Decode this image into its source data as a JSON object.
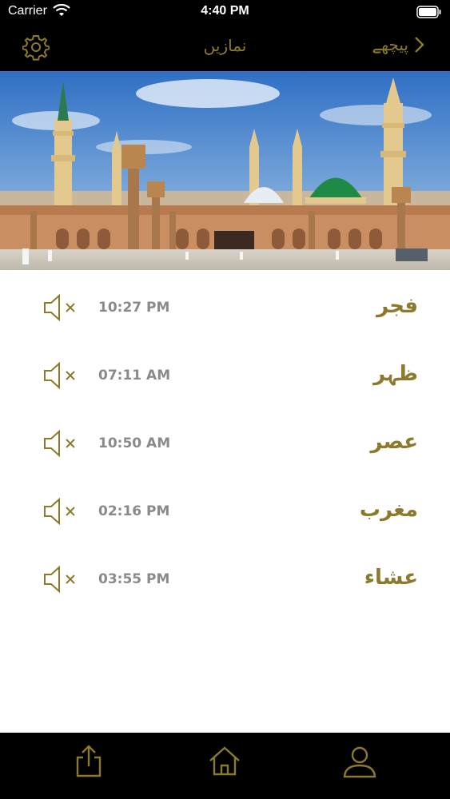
{
  "status_bar": {
    "carrier": "Carrier",
    "time": "4:40 PM",
    "icons": [
      "wifi-icon",
      "battery-icon"
    ]
  },
  "nav": {
    "title": "نمازیں",
    "back_label": "پیچھے",
    "icons": [
      "gear-icon",
      "chevron-left-icon"
    ],
    "accent_color": "#8c7a2c"
  },
  "prayers": [
    {
      "name": "فجر",
      "time": "10:27 PM",
      "icon": "speaker-muted-icon"
    },
    {
      "name": "ظہر",
      "time": "07:11 AM",
      "icon": "speaker-muted-icon"
    },
    {
      "name": "عصر",
      "time": "10:50 AM",
      "icon": "speaker-muted-icon"
    },
    {
      "name": "مغرب",
      "time": "02:16 PM",
      "icon": "speaker-muted-icon"
    },
    {
      "name": "عشاء",
      "time": "03:55 PM",
      "icon": "speaker-muted-icon"
    }
  ],
  "tab_bar": {
    "icons": [
      "share-icon",
      "home-icon",
      "user-icon"
    ]
  }
}
